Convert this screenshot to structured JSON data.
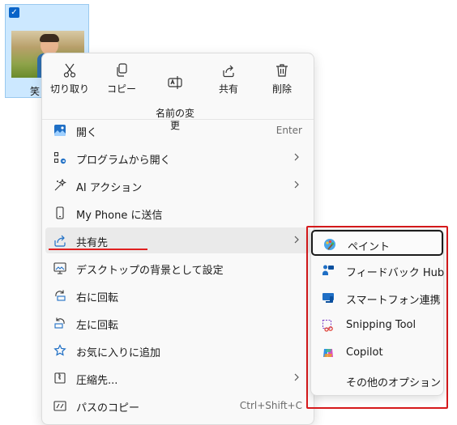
{
  "thumbnail": {
    "label": "笑"
  },
  "quick_actions": [
    {
      "label": "切り取り",
      "icon": "cut-icon"
    },
    {
      "label": "コピー",
      "icon": "copy-icon"
    },
    {
      "label": "名前の変\n更",
      "icon": "rename-icon"
    },
    {
      "label": "共有",
      "icon": "share-icon"
    },
    {
      "label": "削除",
      "icon": "delete-icon"
    }
  ],
  "menu": {
    "items": [
      {
        "label": "開く",
        "shortcut": "Enter",
        "icon": "open-image-icon"
      },
      {
        "label": "プログラムから開く",
        "icon": "open-with-icon"
      },
      {
        "label": "AI アクション",
        "icon": "ai-sparkle-icon"
      },
      {
        "label": "My Phone に送信",
        "icon": "phone-icon"
      },
      {
        "label": "共有先",
        "icon": "share-icon"
      },
      {
        "label": "デスクトップの背景として設定",
        "icon": "wallpaper-icon"
      },
      {
        "label": "右に回転",
        "icon": "rotate-right-icon"
      },
      {
        "label": "左に回転",
        "icon": "rotate-left-icon"
      },
      {
        "label": "お気に入りに追加",
        "icon": "star-icon"
      },
      {
        "label": "圧縮先...",
        "icon": "zip-icon"
      },
      {
        "label": "パスのコピー",
        "shortcut": "Ctrl+Shift+C",
        "icon": "copy-path-icon"
      }
    ]
  },
  "submenu": {
    "items": [
      {
        "label": "ペイント",
        "icon": "paint-icon"
      },
      {
        "label": "フィードバック Hub",
        "icon": "feedback-hub-icon"
      },
      {
        "label": "スマートフォン連携",
        "icon": "phone-link-icon"
      },
      {
        "label": "Snipping Tool",
        "icon": "snipping-tool-icon"
      },
      {
        "label": "Copilot",
        "icon": "copilot-icon"
      },
      {
        "label": "その他のオプション",
        "icon": ""
      }
    ]
  },
  "colors": {
    "accent": "#0a64c8",
    "highlight_box": "#d6191b"
  }
}
